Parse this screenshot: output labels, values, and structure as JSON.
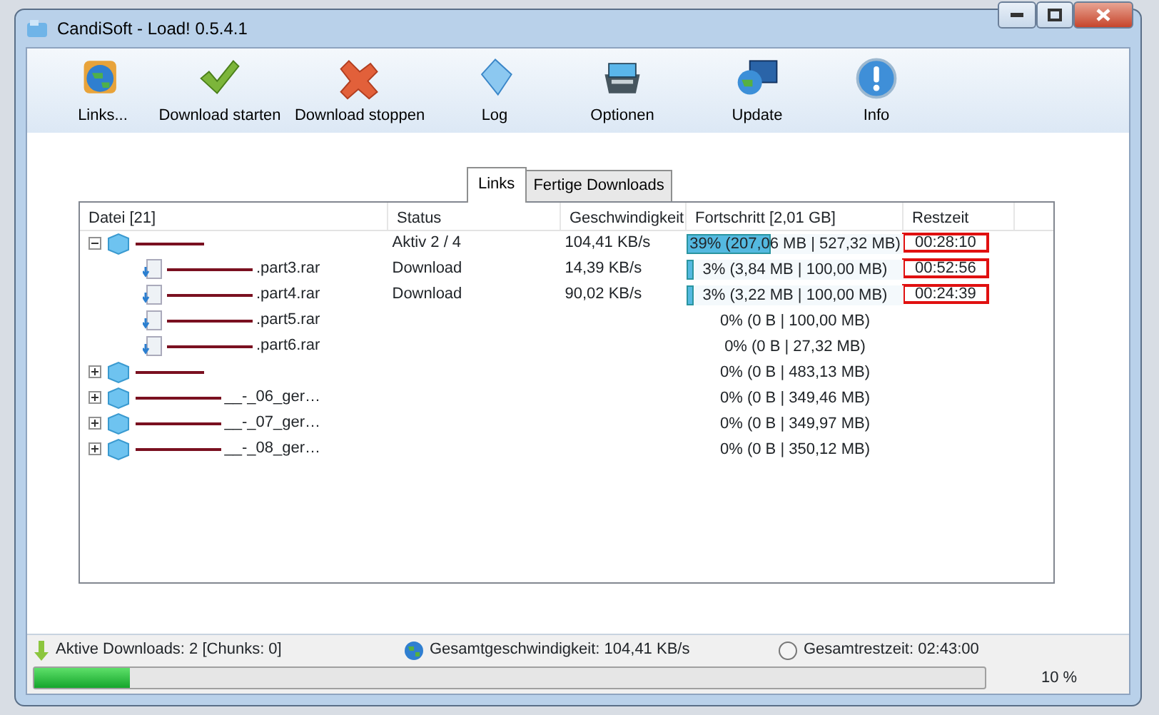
{
  "window": {
    "title": "CandiSoft - Load! 0.5.4.1"
  },
  "toolbar": [
    {
      "kind": "links",
      "label": "Links..."
    },
    {
      "kind": "start",
      "label": "Download starten"
    },
    {
      "kind": "stop",
      "label": "Download stoppen"
    },
    {
      "kind": "log",
      "label": "Log"
    },
    {
      "kind": "options",
      "label": "Optionen"
    },
    {
      "kind": "update",
      "label": "Update"
    },
    {
      "kind": "info",
      "label": "Info"
    }
  ],
  "tabs": [
    {
      "label": "Links",
      "selected": true
    },
    {
      "label": "Fertige Downloads",
      "selected": false
    }
  ],
  "table": {
    "columns": [
      "Datei [21]",
      "Status",
      "Geschwindigkeit",
      "Fortschritt [2,01 GB]",
      "Restzeit"
    ],
    "rows": [
      {
        "name": "",
        "redacted": true,
        "expanded": true,
        "status": "Aktiv 2 / 4",
        "speed": "104,41 KB/s",
        "level": 0.39,
        "progress": "39% (207,06 MB | 527,32 MB)",
        "time": "00:28:10",
        "highlighted": true,
        "children": [
          {
            "name": ".part3.rar",
            "redacted": true,
            "status": "Download",
            "speed": "14,39 KB/s",
            "level": 0.03,
            "progress": "3% (3,84 MB | 100,00 MB)",
            "time": "00:52:56",
            "highlighted": true
          },
          {
            "name": ".part4.rar",
            "redacted": true,
            "status": "Download",
            "speed": "90,02 KB/s",
            "level": 0.03,
            "progress": "3% (3,22 MB | 100,00 MB)",
            "time": "00:24:39",
            "highlighted": true
          },
          {
            "name": ".part5.rar",
            "redacted": true,
            "progress": "0% (0 B | 100,00 MB)"
          },
          {
            "name": ".part6.rar",
            "redacted": true,
            "progress": "0% (0 B | 27,32 MB)"
          }
        ]
      },
      {
        "name": "",
        "redacted": true,
        "expanded": false,
        "progress": "0% (0 B | 483,13 MB)"
      },
      {
        "name": "__-_06_ger…",
        "redacted": true,
        "expanded": false,
        "progress": "0% (0 B | 349,46 MB)"
      },
      {
        "name": "__-_07_ger…",
        "redacted": true,
        "expanded": false,
        "progress": "0% (0 B | 349,97 MB)"
      },
      {
        "name": "__-_08_ger…",
        "redacted": true,
        "expanded": false,
        "progress": "0% (0 B | 350,12 MB)"
      }
    ]
  },
  "status_bar": [
    {
      "kind": "downloads",
      "text": "Aktive Downloads: 2 [Chunks: 0]"
    },
    {
      "kind": "speed",
      "text": "Gesamtgeschwindigkeit: 104,41 KB/s"
    },
    {
      "kind": "time",
      "text": "Gesamtrestzeit: 02:43:00"
    }
  ],
  "overall": {
    "level": 0.1,
    "reading": "10 %"
  }
}
